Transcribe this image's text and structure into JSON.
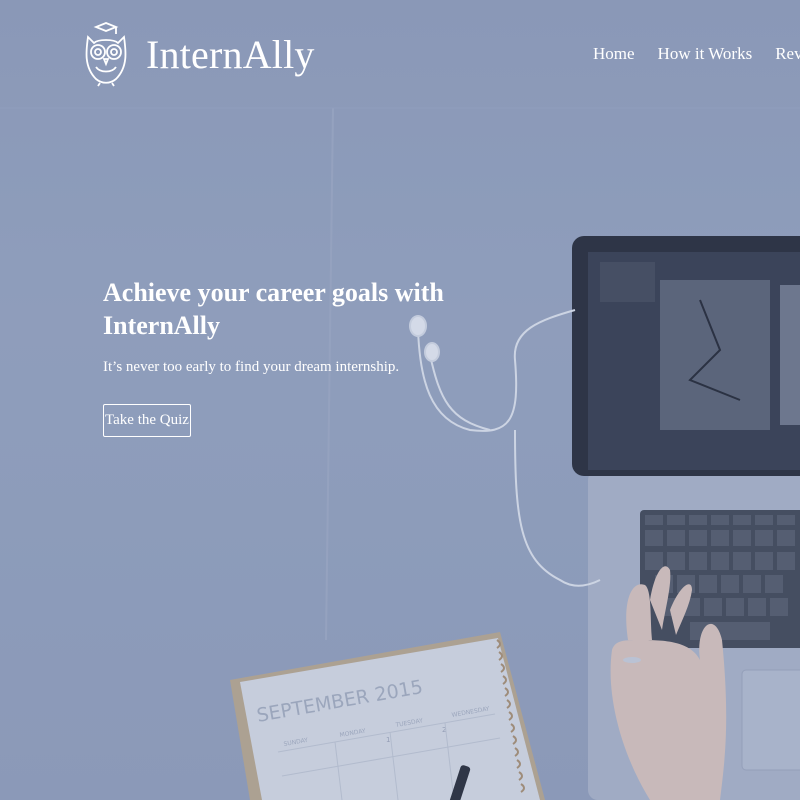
{
  "brand": {
    "name": "InternAlly",
    "logo_icon": "owl-graduate-icon"
  },
  "nav": {
    "items": [
      {
        "label": "Home"
      },
      {
        "label": "How it Works"
      },
      {
        "label": "Revie"
      }
    ]
  },
  "hero": {
    "headline": "Achieve your career goals with InternAlly",
    "tagline": "It’s never too early to find your dream internship.",
    "cta_label": "Take the Quiz",
    "background_photo": {
      "calendar_title": "SEPTEMBER 2015",
      "calendar_days": [
        "SUNDAY",
        "MONDAY",
        "TUESDAY",
        "WEDNESDAY"
      ],
      "calendar_dates": [
        "1",
        "2"
      ]
    }
  },
  "colors": {
    "overlay": "#8d9bb8",
    "text": "#ffffff",
    "laptop_screen": "#1f2533",
    "keyboard": "#3a4150"
  }
}
